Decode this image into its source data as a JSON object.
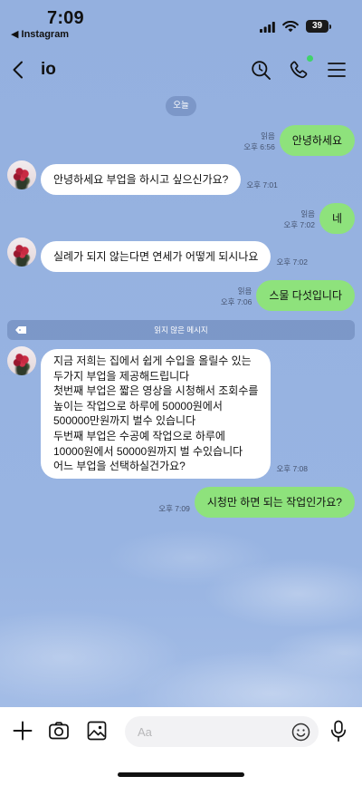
{
  "status_bar": {
    "time": "7:09",
    "back_to_app": "◀ Instagram",
    "battery": "39"
  },
  "header": {
    "title": "io"
  },
  "date_separator": "오늘",
  "messages": [
    {
      "lines": [
        "안녕하세요"
      ],
      "read": "읽음",
      "time": "오후 6:56"
    },
    {
      "lines": [
        "안녕하세요 부업을 하시고 싶으신가요?"
      ],
      "time": "오후 7:01"
    },
    {
      "lines": [
        "네"
      ],
      "read": "읽음",
      "time": "오후 7:02"
    },
    {
      "lines": [
        "실례가 되지 않는다면 연세가 어떻게 되시나요"
      ],
      "time": "오후 7:02"
    },
    {
      "lines": [
        "스물 다섯입니다"
      ],
      "read": "읽음",
      "time": "오후 7:06"
    },
    {
      "lines": [
        "지금 저희는 집에서 쉽게 수입을 올릴수 있는",
        "두가지 부업을 제공해드립니다",
        "첫번째 부업은 짧은 영상을 시청해서 조회수를",
        "높이는 작업으로 하루에 50000원에서",
        "500000만원까지 벌수 있습니다",
        "두번째 부업은 수공예 작업으로 하루에",
        "10000원에서 50000원까지 벌 수있습니다",
        "어느 부업을 선택하실건가요?"
      ],
      "time": "오후 7:08"
    },
    {
      "lines": [
        "시청만 하면 되는 작업인가요?"
      ],
      "time": "오후 7:09"
    }
  ],
  "unread_divider": "읽지 않은 메시지",
  "composer": {
    "placeholder": "Aa"
  },
  "icons": {
    "back": "chevron-left-icon",
    "search": "search-icon",
    "call": "phone-icon",
    "menu": "menu-icon",
    "add": "plus-icon",
    "camera": "camera-icon",
    "gallery": "image-icon",
    "emoji": "emoji-icon",
    "voice": "mic-icon"
  },
  "colors": {
    "background": "#94b0df",
    "outgoing_bubble": "#8ee27c",
    "incoming_bubble": "#ffffff",
    "online_indicator": "#3fd36a"
  }
}
